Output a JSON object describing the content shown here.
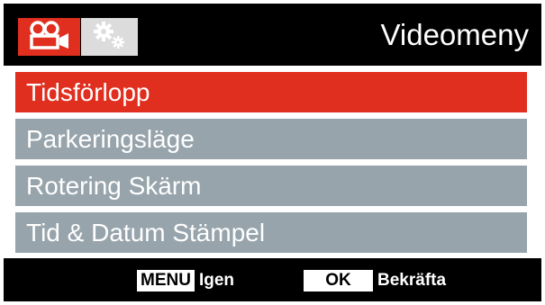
{
  "header": {
    "title": "Videomeny",
    "tabs": [
      {
        "icon": "video-camera-icon",
        "active": true
      },
      {
        "icon": "gears-icon",
        "active": false
      }
    ]
  },
  "menu": {
    "items": [
      {
        "label": "Tidsförlopp",
        "selected": true
      },
      {
        "label": "Parkeringsläge",
        "selected": false
      },
      {
        "label": "Rotering Skärm",
        "selected": false
      },
      {
        "label": "Tid & Datum Stämpel",
        "selected": false
      }
    ]
  },
  "footer": {
    "menu_key": "MENU",
    "menu_action": "Igen",
    "ok_key": "OK",
    "ok_action": "Bekräfta"
  },
  "colors": {
    "accent": "#e02e1f",
    "item_bg": "#97a4ab",
    "bar_bg": "#000000"
  }
}
